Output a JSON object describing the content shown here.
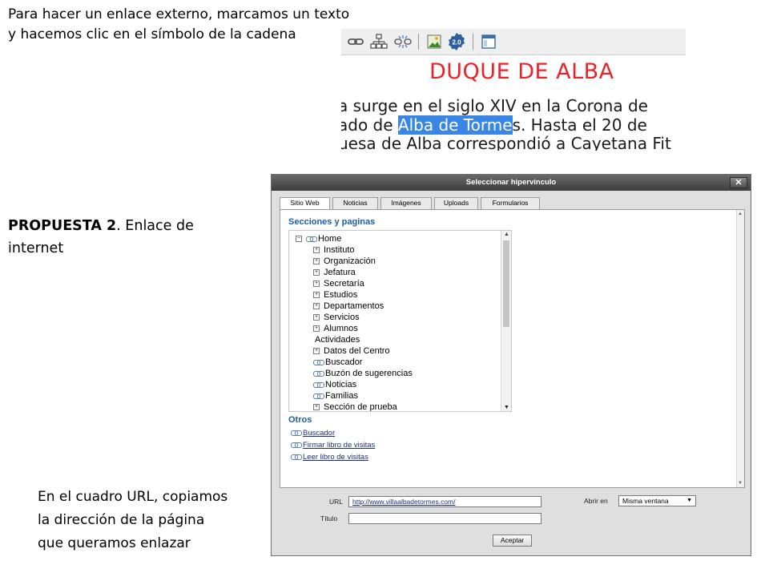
{
  "captions": {
    "top_line1": "Para hacer un enlace externo, marcamos un texto",
    "top_line2": "y hacemos clic en el símbolo de la cadena",
    "proposal_bold": "PROPUESTA 2",
    "proposal_rest": ". Enlace de internet",
    "url_line1": "En el cuadro URL, copiamos",
    "url_line2": "la dirección de la página",
    "url_line3": "que queramos enlazar"
  },
  "editor": {
    "toolbar_icons": [
      "link-icon",
      "sitemap-icon",
      "unlink-icon",
      "image-icon",
      "web20-badge-icon",
      "template-icon"
    ],
    "badge_text": "2.0",
    "heading": "DUQUE DE ALBA",
    "line1": "a surge en el siglo XIV en la Corona de",
    "line2_before": "ado de ",
    "line2_selected": "Alba de Torme",
    "line2_after": "s. Hasta el 20 de",
    "line3": "uesa de Alba correspondió a Cayetana Fit",
    "colors": {
      "heading": "#e8242a",
      "selection": "#3a86e6"
    }
  },
  "dialog": {
    "title": "Seleccionar hipervínculo",
    "close_label": "✕",
    "tabs": [
      {
        "label": "Sitio Web",
        "active": true
      },
      {
        "label": "Noticias",
        "active": false
      },
      {
        "label": "Imágenes",
        "active": false
      },
      {
        "label": "Uploads",
        "active": false
      },
      {
        "label": "Formularios",
        "active": false
      }
    ],
    "sections_title": "Secciones y paginas",
    "tree": [
      {
        "label": "Home",
        "icon": "link",
        "expander": "⊟"
      },
      {
        "label": "Instituto",
        "expander": "⊞"
      },
      {
        "label": "Organización",
        "expander": "⊞"
      },
      {
        "label": "Jefatura",
        "expander": "⊞"
      },
      {
        "label": "Secretaría",
        "expander": "⊞"
      },
      {
        "label": "Estudios",
        "expander": "⊞"
      },
      {
        "label": "Departamentos",
        "expander": "⊞"
      },
      {
        "label": "Servicios",
        "expander": "⊞"
      },
      {
        "label": "Alumnos",
        "expander": "⊞"
      },
      {
        "label": "Actividades"
      },
      {
        "label": "Datos del Centro",
        "expander": "⊞"
      },
      {
        "label": "Buscador",
        "icon": "link"
      },
      {
        "label": "Buzón de sugerencias",
        "icon": "link"
      },
      {
        "label": "Noticias",
        "icon": "link"
      },
      {
        "label": "Familias",
        "icon": "link"
      },
      {
        "label": "Sección de prueba",
        "expander": "⊞"
      }
    ],
    "otros_title": "Otros",
    "otros": [
      {
        "label": "Buscador"
      },
      {
        "label": "Firmar libro de visitas"
      },
      {
        "label": "Leer libro de visitas"
      }
    ],
    "url_label": "URL",
    "url_value": "http://www.villaalbadetormes.com/",
    "title_label": "Título",
    "title_value": "",
    "open_in_label": "Abrir en",
    "open_in_value": "Misma ventana",
    "accept_label": "Aceptar"
  }
}
